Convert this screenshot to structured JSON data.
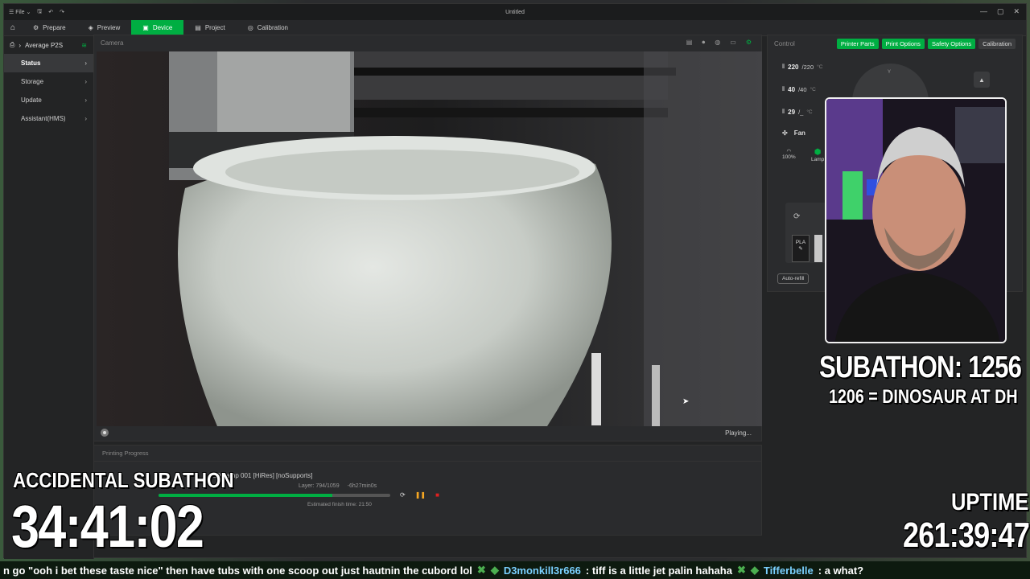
{
  "app": {
    "title": "Untitled",
    "file_menu": "File"
  },
  "nav": {
    "tabs": [
      {
        "label": "Prepare",
        "icon": "prepare-icon"
      },
      {
        "label": "Preview",
        "icon": "preview-icon"
      },
      {
        "label": "Device",
        "icon": "device-icon",
        "active": true
      },
      {
        "label": "Project",
        "icon": "project-icon"
      },
      {
        "label": "Calibration",
        "icon": "calibration-icon"
      }
    ]
  },
  "sidebar": {
    "printer": "Average P2S",
    "items": [
      {
        "label": "Status",
        "active": true
      },
      {
        "label": "Storage"
      },
      {
        "label": "Update"
      },
      {
        "label": "Assistant(HMS)"
      }
    ]
  },
  "camera": {
    "title": "Camera",
    "status": "Playing..."
  },
  "progress": {
    "title": "Printing Progress",
    "job": "LED Lamp 001 [HiRes] [noSupports]",
    "layer": "Layer: 794/1059",
    "remaining": "-6h27min0s",
    "finish": "Estimated finish time: 21:50",
    "progress_fraction": 0.75
  },
  "control": {
    "title": "Control",
    "tabs": [
      "Printer Parts",
      "Print Options",
      "Safety Options",
      "Calibration"
    ],
    "temps": [
      {
        "current": "220",
        "target": "/220",
        "unit": "°C"
      },
      {
        "current": "40",
        "target": "/40",
        "unit": "°C"
      },
      {
        "current": "29",
        "target": "/_",
        "unit": "°C"
      }
    ],
    "fan_label": "Fan",
    "fan_speed": "100%",
    "lamp_label": "Lamp",
    "dial_label": "Y",
    "filament": "PLA",
    "auto_refill": "Auto-refill"
  },
  "overlay": {
    "subathon_count": "SUBATHON: 1256",
    "subathon_goal": "1206 = DINOSAUR AT DH",
    "accidental_title": "ACCIDENTAL SUBATHON",
    "accidental_timer": "34:41:02",
    "uptime_label": "UPTIME",
    "uptime_value": "261:39:47"
  },
  "ticker": {
    "msg1": "n go \"ooh i bet these taste nice\" then have tubs with one scoop out just hautnin the cubord lol",
    "user2": "D3monkill3r666",
    "msg2": ": tiff is a little jet palin hahaha",
    "user3": "Tifferbelle",
    "msg3": ": a what?"
  },
  "colors": {
    "accent": "#00ae42",
    "pause": "#f5a623",
    "stop": "#e02020"
  }
}
